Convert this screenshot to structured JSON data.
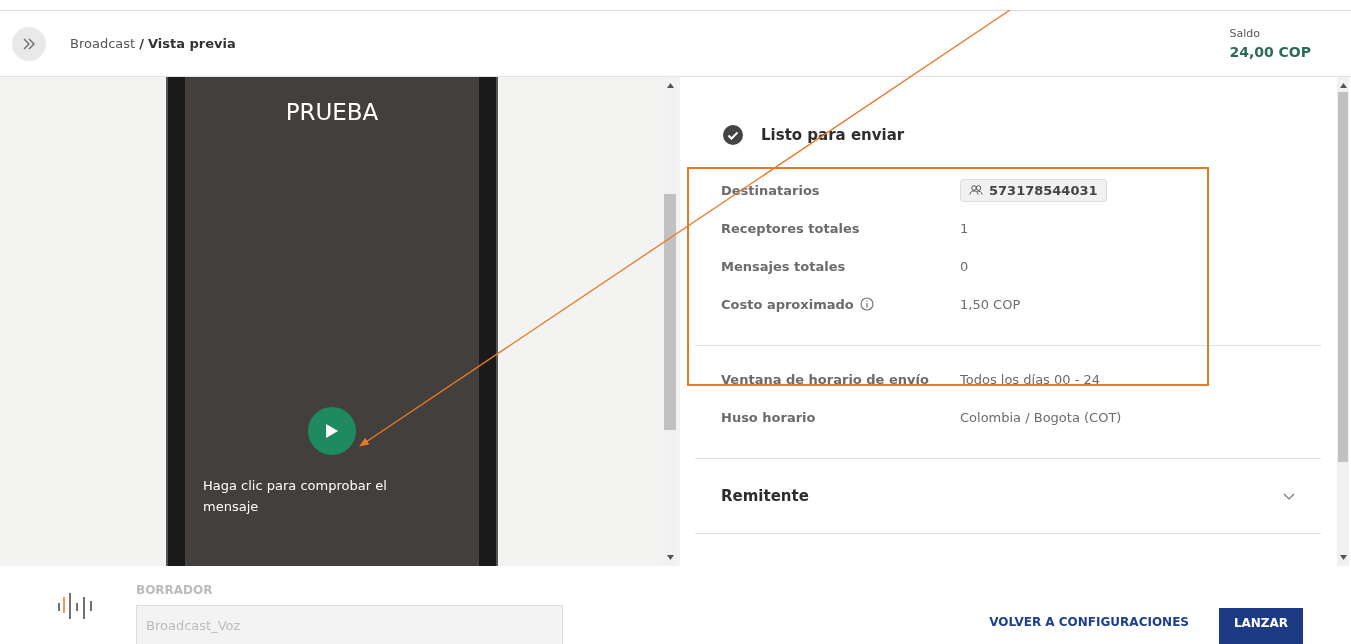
{
  "header": {
    "breadcrumb_parent": "Broadcast",
    "breadcrumb_separator": "/",
    "breadcrumb_current": "Vista previa",
    "balance_label": "Saldo",
    "balance_value": "24,00 COP"
  },
  "preview": {
    "title": "PRUEBA",
    "caption": "Haga clic para comprobar el mensaje"
  },
  "summary": {
    "status": "Listo para enviar",
    "groups": [
      {
        "rows": [
          {
            "label": "Destinatarios",
            "value": "573178544031",
            "kind": "chip",
            "hint": false
          },
          {
            "label": "Receptores totales",
            "value": "1",
            "kind": "plain",
            "hint": false
          },
          {
            "label": "Mensajes totales",
            "value": "0",
            "kind": "plain",
            "hint": false
          },
          {
            "label": "Costo aproximado",
            "value": "1,50 COP",
            "kind": "plain",
            "hint": true
          }
        ]
      },
      {
        "rows": [
          {
            "label": "Ventana de horario de envío",
            "value": "Todos los días 00 - 24",
            "kind": "plain",
            "hint": false
          },
          {
            "label": "Huso horario",
            "value": "Colombia / Bogota (COT)",
            "kind": "plain",
            "hint": false
          }
        ]
      }
    ],
    "sections": [
      {
        "title": "Remitente",
        "expanded": false
      }
    ]
  },
  "footer": {
    "draft_label": "BORRADOR",
    "draft_value": "Broadcast_Voz",
    "back_button": "VOLVER A CONFIGURACIONES",
    "launch_button": "LANZAR"
  }
}
